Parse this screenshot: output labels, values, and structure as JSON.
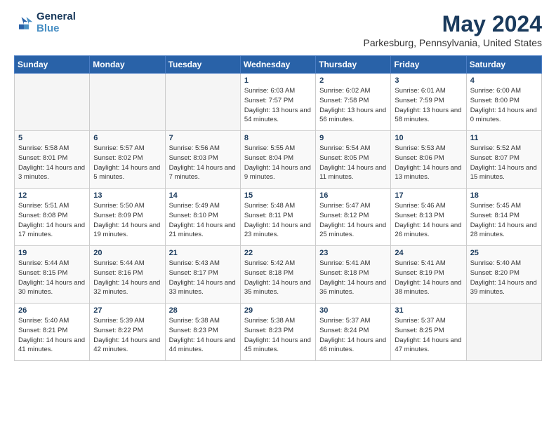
{
  "logo": {
    "line1": "General",
    "line2": "Blue"
  },
  "title": "May 2024",
  "subtitle": "Parkesburg, Pennsylvania, United States",
  "weekdays": [
    "Sunday",
    "Monday",
    "Tuesday",
    "Wednesday",
    "Thursday",
    "Friday",
    "Saturday"
  ],
  "weeks": [
    [
      {
        "day": "",
        "empty": true
      },
      {
        "day": "",
        "empty": true
      },
      {
        "day": "",
        "empty": true
      },
      {
        "day": "1",
        "sunrise": "6:03 AM",
        "sunset": "7:57 PM",
        "daylight": "13 hours and 54 minutes."
      },
      {
        "day": "2",
        "sunrise": "6:02 AM",
        "sunset": "7:58 PM",
        "daylight": "13 hours and 56 minutes."
      },
      {
        "day": "3",
        "sunrise": "6:01 AM",
        "sunset": "7:59 PM",
        "daylight": "13 hours and 58 minutes."
      },
      {
        "day": "4",
        "sunrise": "6:00 AM",
        "sunset": "8:00 PM",
        "daylight": "14 hours and 0 minutes."
      }
    ],
    [
      {
        "day": "5",
        "sunrise": "5:58 AM",
        "sunset": "8:01 PM",
        "daylight": "14 hours and 3 minutes."
      },
      {
        "day": "6",
        "sunrise": "5:57 AM",
        "sunset": "8:02 PM",
        "daylight": "14 hours and 5 minutes."
      },
      {
        "day": "7",
        "sunrise": "5:56 AM",
        "sunset": "8:03 PM",
        "daylight": "14 hours and 7 minutes."
      },
      {
        "day": "8",
        "sunrise": "5:55 AM",
        "sunset": "8:04 PM",
        "daylight": "14 hours and 9 minutes."
      },
      {
        "day": "9",
        "sunrise": "5:54 AM",
        "sunset": "8:05 PM",
        "daylight": "14 hours and 11 minutes."
      },
      {
        "day": "10",
        "sunrise": "5:53 AM",
        "sunset": "8:06 PM",
        "daylight": "14 hours and 13 minutes."
      },
      {
        "day": "11",
        "sunrise": "5:52 AM",
        "sunset": "8:07 PM",
        "daylight": "14 hours and 15 minutes."
      }
    ],
    [
      {
        "day": "12",
        "sunrise": "5:51 AM",
        "sunset": "8:08 PM",
        "daylight": "14 hours and 17 minutes."
      },
      {
        "day": "13",
        "sunrise": "5:50 AM",
        "sunset": "8:09 PM",
        "daylight": "14 hours and 19 minutes."
      },
      {
        "day": "14",
        "sunrise": "5:49 AM",
        "sunset": "8:10 PM",
        "daylight": "14 hours and 21 minutes."
      },
      {
        "day": "15",
        "sunrise": "5:48 AM",
        "sunset": "8:11 PM",
        "daylight": "14 hours and 23 minutes."
      },
      {
        "day": "16",
        "sunrise": "5:47 AM",
        "sunset": "8:12 PM",
        "daylight": "14 hours and 25 minutes."
      },
      {
        "day": "17",
        "sunrise": "5:46 AM",
        "sunset": "8:13 PM",
        "daylight": "14 hours and 26 minutes."
      },
      {
        "day": "18",
        "sunrise": "5:45 AM",
        "sunset": "8:14 PM",
        "daylight": "14 hours and 28 minutes."
      }
    ],
    [
      {
        "day": "19",
        "sunrise": "5:44 AM",
        "sunset": "8:15 PM",
        "daylight": "14 hours and 30 minutes."
      },
      {
        "day": "20",
        "sunrise": "5:44 AM",
        "sunset": "8:16 PM",
        "daylight": "14 hours and 32 minutes."
      },
      {
        "day": "21",
        "sunrise": "5:43 AM",
        "sunset": "8:17 PM",
        "daylight": "14 hours and 33 minutes."
      },
      {
        "day": "22",
        "sunrise": "5:42 AM",
        "sunset": "8:18 PM",
        "daylight": "14 hours and 35 minutes."
      },
      {
        "day": "23",
        "sunrise": "5:41 AM",
        "sunset": "8:18 PM",
        "daylight": "14 hours and 36 minutes."
      },
      {
        "day": "24",
        "sunrise": "5:41 AM",
        "sunset": "8:19 PM",
        "daylight": "14 hours and 38 minutes."
      },
      {
        "day": "25",
        "sunrise": "5:40 AM",
        "sunset": "8:20 PM",
        "daylight": "14 hours and 39 minutes."
      }
    ],
    [
      {
        "day": "26",
        "sunrise": "5:40 AM",
        "sunset": "8:21 PM",
        "daylight": "14 hours and 41 minutes."
      },
      {
        "day": "27",
        "sunrise": "5:39 AM",
        "sunset": "8:22 PM",
        "daylight": "14 hours and 42 minutes."
      },
      {
        "day": "28",
        "sunrise": "5:38 AM",
        "sunset": "8:23 PM",
        "daylight": "14 hours and 44 minutes."
      },
      {
        "day": "29",
        "sunrise": "5:38 AM",
        "sunset": "8:23 PM",
        "daylight": "14 hours and 45 minutes."
      },
      {
        "day": "30",
        "sunrise": "5:37 AM",
        "sunset": "8:24 PM",
        "daylight": "14 hours and 46 minutes."
      },
      {
        "day": "31",
        "sunrise": "5:37 AM",
        "sunset": "8:25 PM",
        "daylight": "14 hours and 47 minutes."
      },
      {
        "day": "",
        "empty": true
      }
    ]
  ]
}
